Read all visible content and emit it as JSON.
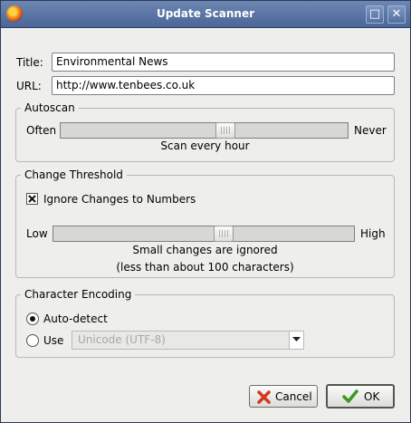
{
  "window": {
    "title": "Update Scanner",
    "maximize_glyph": "□",
    "close_glyph": "✕"
  },
  "fields": {
    "title_label": "Title:",
    "title_value": "Environmental News",
    "url_label": "URL:",
    "url_value": "http://www.tenbees.co.uk"
  },
  "autoscan": {
    "heading": "Autoscan",
    "min_label": "Often",
    "max_label": "Never",
    "level": 0.58,
    "status": "Scan every hour"
  },
  "threshold": {
    "heading": "Change Threshold",
    "ignore_numbers_label": "Ignore Changes to Numbers",
    "ignore_numbers_checked": true,
    "min_label": "Low",
    "max_label": "High",
    "level": 0.57,
    "status_line1": "Small changes are ignored",
    "status_line2": "(less than about 100 characters)"
  },
  "encoding": {
    "heading": "Character Encoding",
    "auto_label": "Auto-detect",
    "use_label": "Use",
    "selected": "auto",
    "combo_value": "Unicode (UTF-8)"
  },
  "buttons": {
    "cancel_label": "Cancel",
    "ok_label": "OK"
  },
  "colors": {
    "titlebar": "#4a6697",
    "cancel_icon": "#d6361f",
    "ok_icon": "#3a9a1e"
  }
}
